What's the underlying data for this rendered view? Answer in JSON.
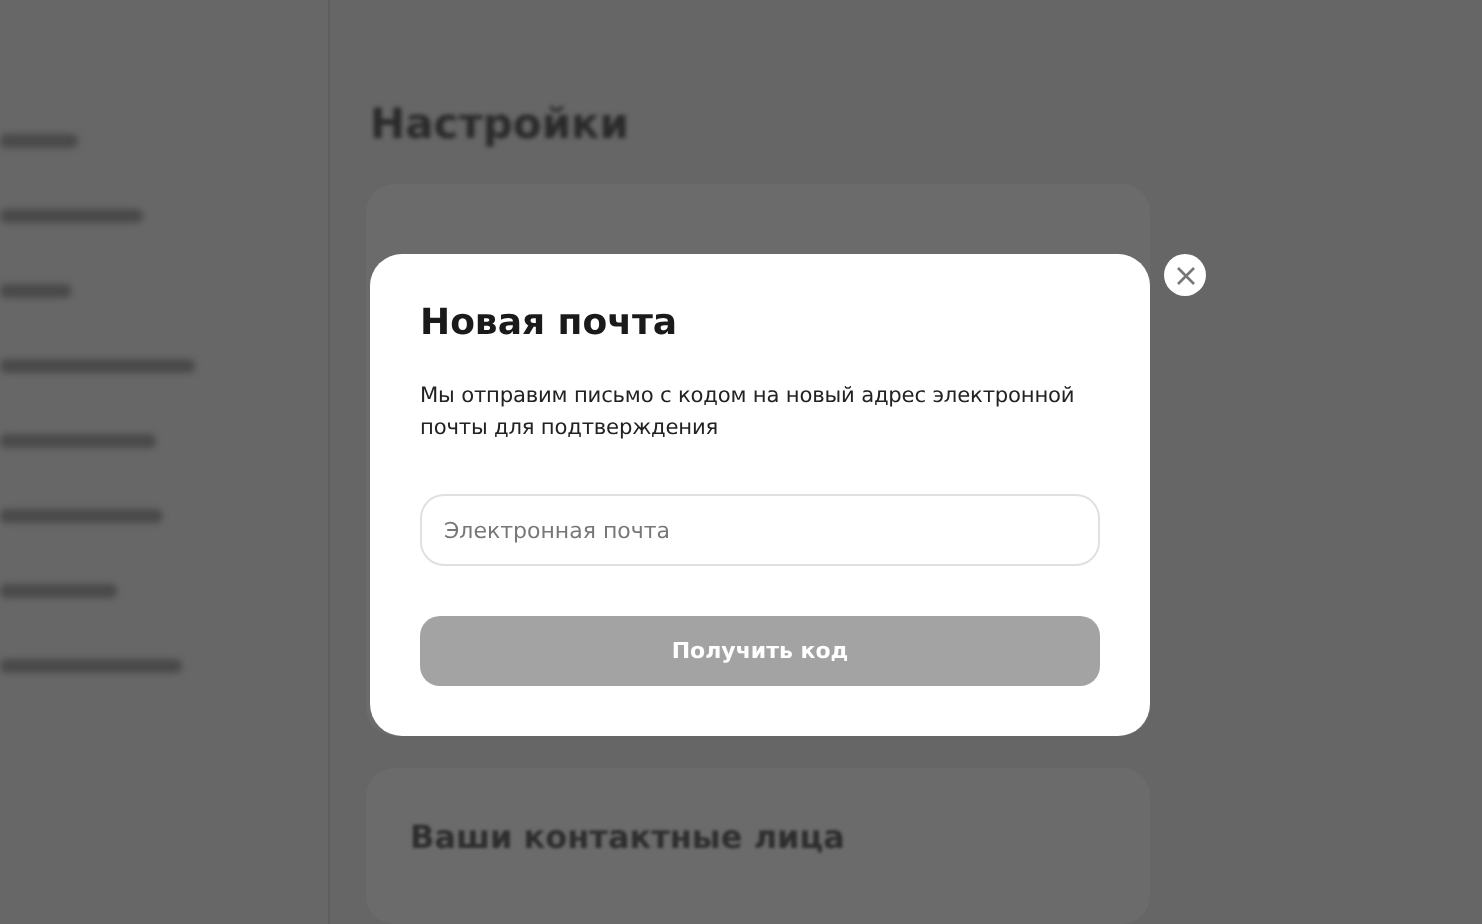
{
  "page": {
    "title": "Настройки",
    "contacts_title": "Ваши контактные лица"
  },
  "modal": {
    "title": "Новая почта",
    "text": "Мы отправим письмо с кодом на новый адрес электронной почты для подтверждения",
    "email_field": {
      "placeholder": "Электронная почта"
    },
    "submit": {
      "label": "Получить код",
      "disabled": true
    }
  }
}
